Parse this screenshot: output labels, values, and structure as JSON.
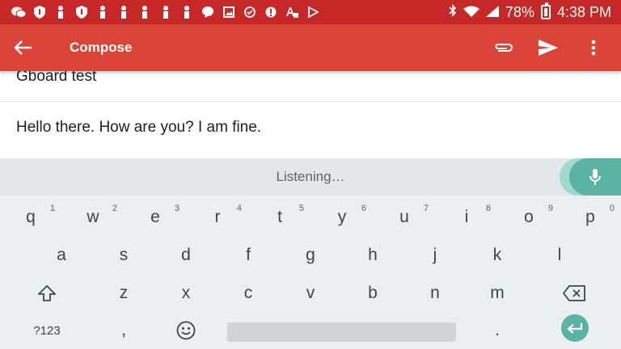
{
  "status_bar": {
    "notification_icons": [
      "wechat-icon",
      "shield-icon",
      "person-icon",
      "shield-icon",
      "person-icon",
      "person-icon",
      "person-icon",
      "person-icon",
      "person-icon",
      "chat-bubble-icon",
      "image-icon",
      "check-circle-icon",
      "info-circle-icon",
      "a-lock-icon",
      "play-store-icon"
    ],
    "battery": "78%",
    "time": "4:38 PM"
  },
  "app_bar": {
    "title": "Compose",
    "color": "#db4437"
  },
  "compose": {
    "subject": "Gboard test",
    "body": "Hello there. How are you? I am fine."
  },
  "keyboard": {
    "status": "Listening…",
    "accent": "#5bb3a3",
    "row1": [
      {
        "label": "q",
        "hint": "1"
      },
      {
        "label": "w",
        "hint": "2"
      },
      {
        "label": "e",
        "hint": "3"
      },
      {
        "label": "r",
        "hint": "4"
      },
      {
        "label": "t",
        "hint": "5"
      },
      {
        "label": "y",
        "hint": "6"
      },
      {
        "label": "u",
        "hint": "7"
      },
      {
        "label": "i",
        "hint": "8"
      },
      {
        "label": "o",
        "hint": "9"
      },
      {
        "label": "p",
        "hint": "0"
      }
    ],
    "row2": [
      "a",
      "s",
      "d",
      "f",
      "g",
      "h",
      "j",
      "k",
      "l"
    ],
    "row3": [
      "z",
      "x",
      "c",
      "v",
      "b",
      "n",
      "m"
    ],
    "symbols_label": "?123",
    "comma": ",",
    "period": "."
  }
}
